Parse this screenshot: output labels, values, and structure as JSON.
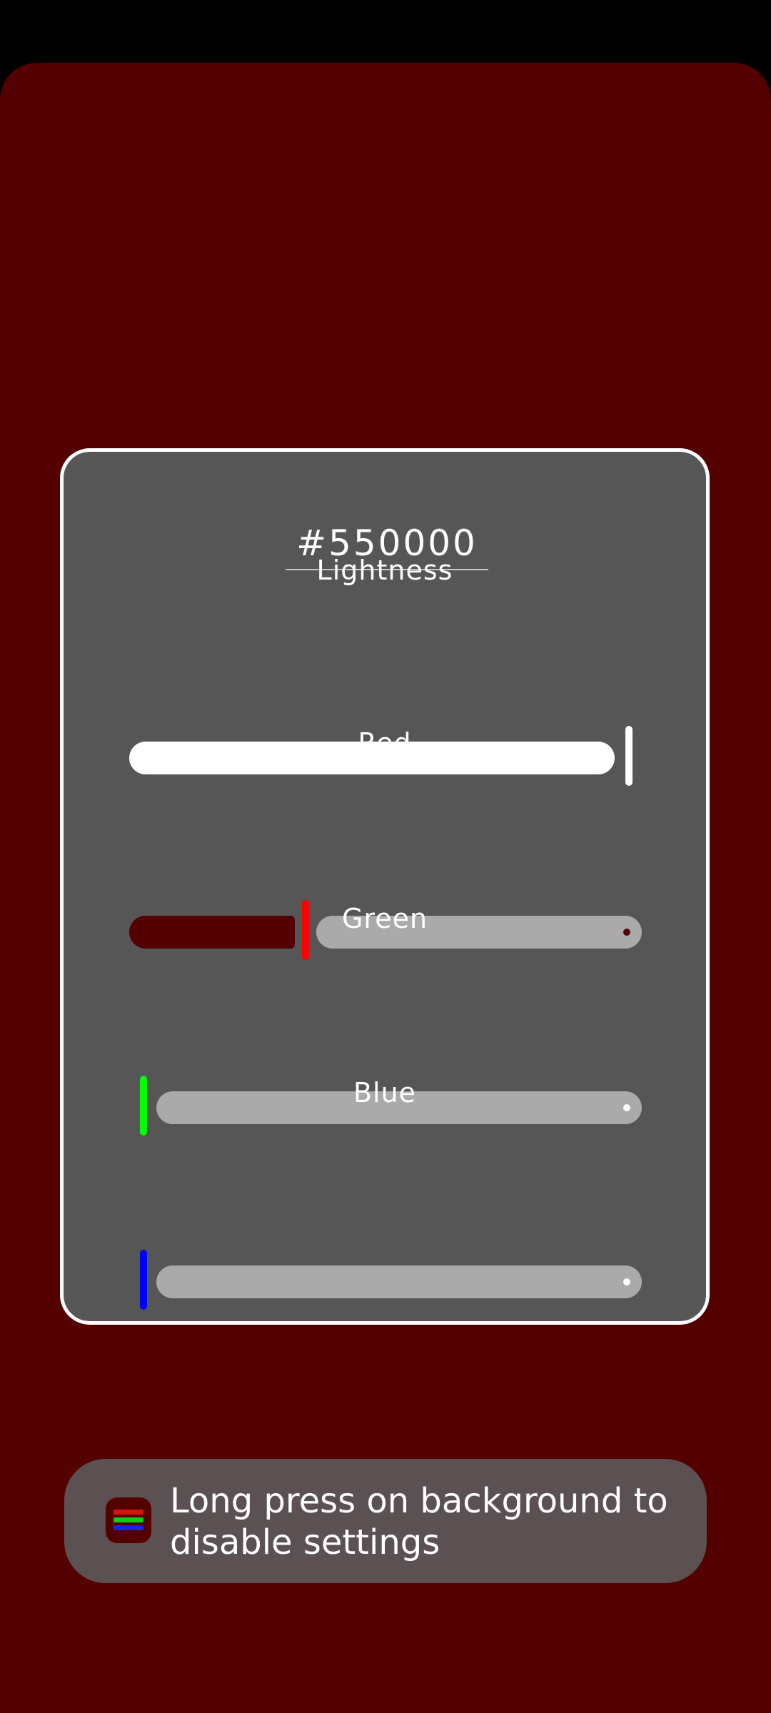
{
  "dialog": {
    "hex_value": "#550000"
  },
  "sliders": [
    {
      "id": "lightness",
      "label": "Lightness",
      "value_fraction": 1.0,
      "accent_color": "#ffffff"
    },
    {
      "id": "red",
      "label": "Red",
      "value_fraction": 0.333,
      "accent_color": "#ff0000"
    },
    {
      "id": "green",
      "label": "Green",
      "value_fraction": 0.0,
      "accent_color": "#00ff00"
    },
    {
      "id": "blue",
      "label": "Blue",
      "value_fraction": 0.0,
      "accent_color": "#0000ff"
    }
  ],
  "toast": {
    "message": "Long press on background to disable settings",
    "icon": "rgb-sliders-app-icon"
  },
  "colors": {
    "background": "#550000",
    "panel": "#565656",
    "panel_border": "#ffffff",
    "track": "#aaaaaa",
    "toast_background": "#5b5052"
  }
}
